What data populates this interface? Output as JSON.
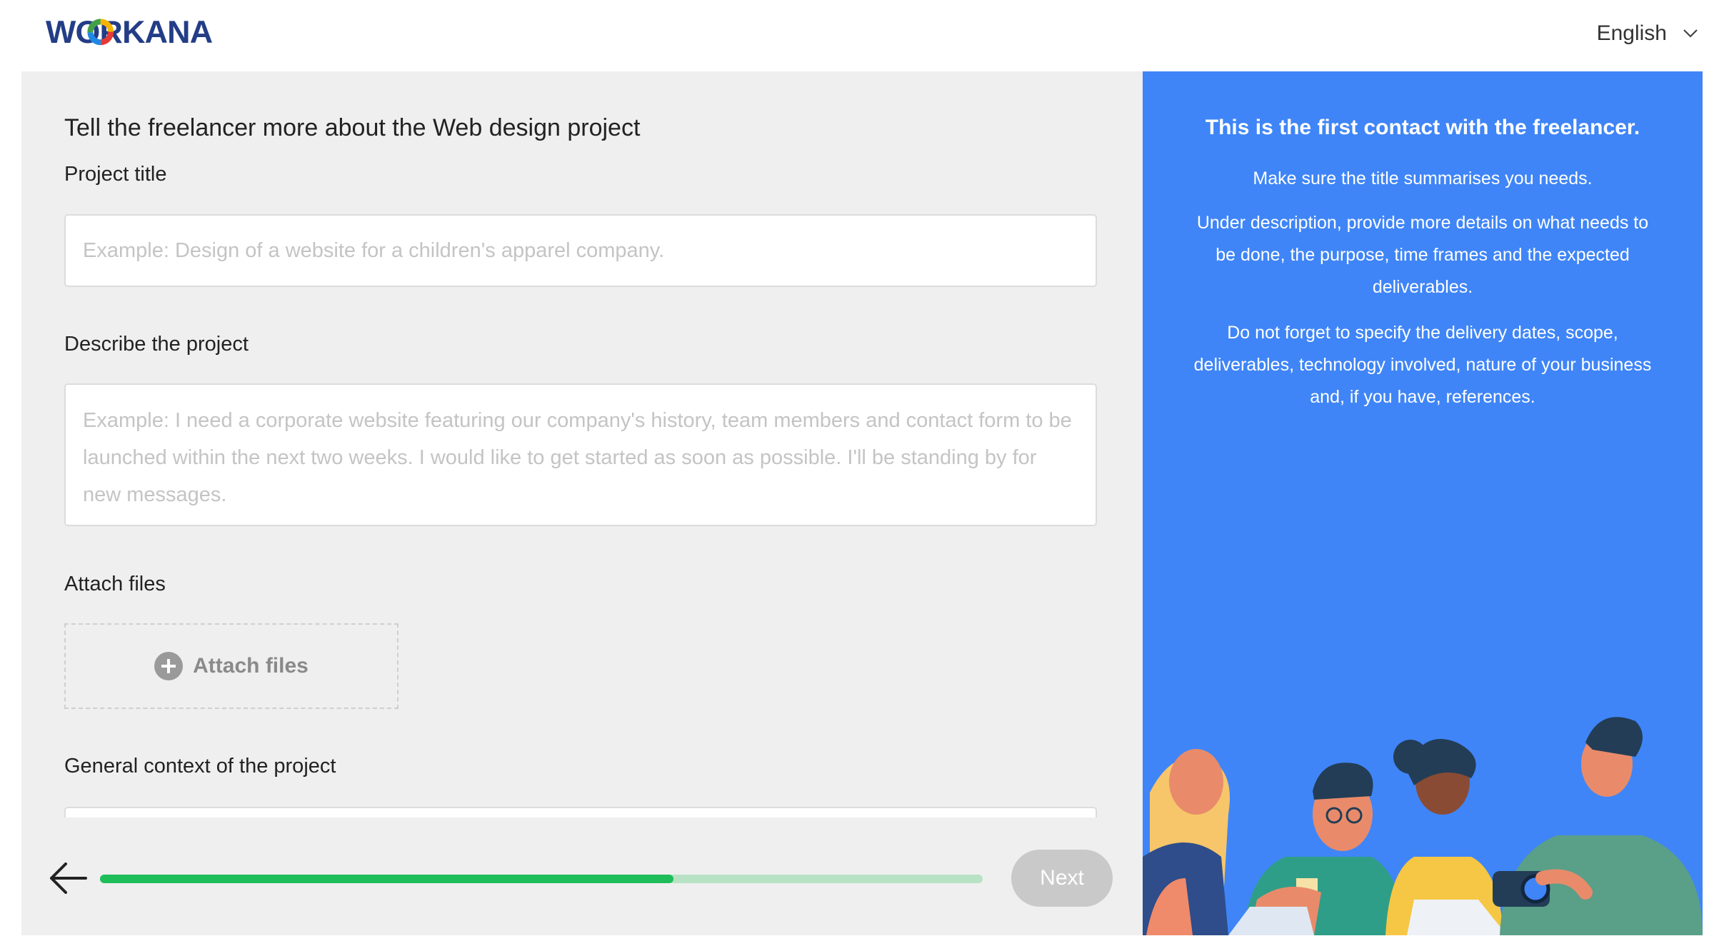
{
  "header": {
    "logo_text": "WORKANA",
    "language": "English"
  },
  "form": {
    "heading": "Tell the freelancer more about the Web design project",
    "title_label": "Project title",
    "title_placeholder": "Example: Design of a website for a children's apparel company.",
    "title_value": "",
    "description_label": "Describe the project",
    "description_placeholder": "Example: I need a corporate website featuring our company's history, team members and contact form to be launched within the next two weeks. I would like to get started as soon as possible. I'll be standing by for new messages.",
    "description_value": "",
    "attach_label": "Attach files",
    "attach_button": "Attach files",
    "context_label": "General context of the project"
  },
  "footer": {
    "progress": 0.65,
    "next_label": "Next"
  },
  "tips": {
    "title": "This is the first contact with the freelancer.",
    "line1": "Make sure the title summarises you needs.",
    "line2": "Under description, provide more details on what needs to be done, the purpose, time frames and the expected deliverables.",
    "line3": "Do not forget to specify the delivery dates, scope, deliverables, technology involved, nature of your business and, if you have, references."
  },
  "colors": {
    "accent_blue": "#3f85f7",
    "progress_fill": "#1fbd5a",
    "progress_track": "#b7e3c4",
    "panel_gray": "#efefef"
  }
}
